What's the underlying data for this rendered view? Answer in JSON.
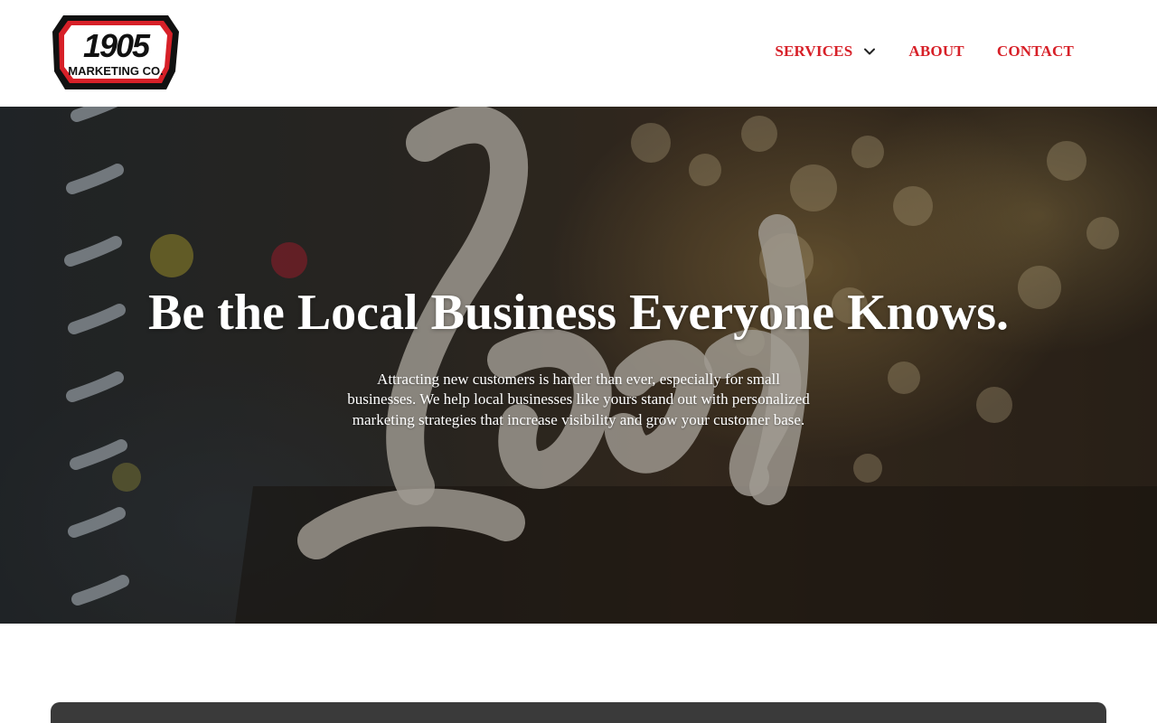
{
  "brand": {
    "logo_number": "1905",
    "logo_text": "MARKETING CO.",
    "colors": {
      "accent": "#d72028",
      "dark": "#111111",
      "white": "#ffffff"
    }
  },
  "nav": {
    "items": [
      {
        "label": "SERVICES",
        "icon": "chevron-down-icon"
      },
      {
        "label": "ABOUT"
      },
      {
        "label": "CONTACT"
      }
    ]
  },
  "hero": {
    "title": "Be the Local Business Everyone Knows.",
    "text": "Attracting new customers is harder than ever, especially for small businesses. We help local businesses like yours stand out with personalized marketing strategies that increase visibility and grow your customer base.",
    "background_sign_text": "Local"
  },
  "card": {
    "color": "#3a3a3a"
  }
}
